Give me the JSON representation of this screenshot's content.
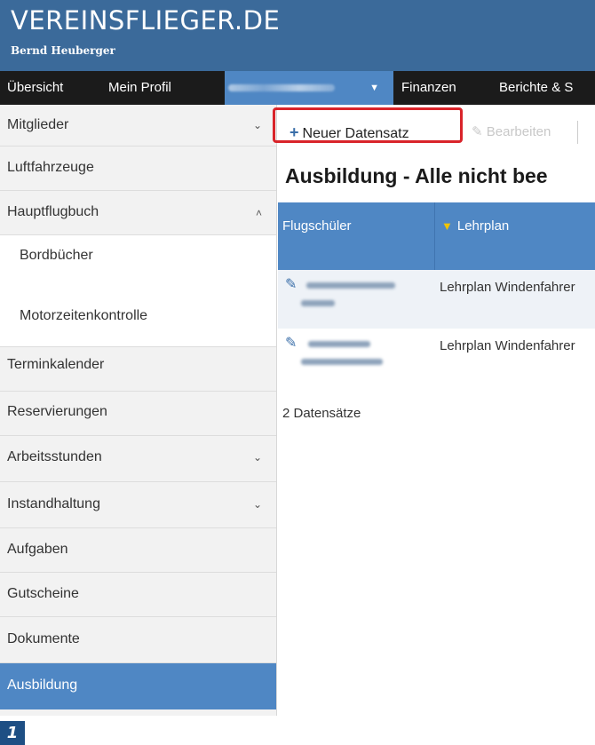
{
  "header": {
    "brand": "VEREINSFLIEGER.DE",
    "username": "Bernd Heuberger",
    "background_color": "#3b6a9a"
  },
  "navbar": {
    "items": [
      {
        "label": "Übersicht"
      },
      {
        "label": "Mein Profil"
      },
      {
        "label": "",
        "redacted": true,
        "active": true,
        "dropdown": true
      },
      {
        "label": "Finanzen"
      },
      {
        "label": "Berichte & S"
      }
    ],
    "active_color": "#4f87c4"
  },
  "sidebar": {
    "items": [
      {
        "label": "Mitglieder",
        "chevron": "chevron-down-icon"
      },
      {
        "label": "Luftfahrzeuge"
      },
      {
        "label": "Hauptflugbuch",
        "chevron": "chevron-up-icon"
      },
      {
        "label": "Bordbücher",
        "sub": true
      },
      {
        "label": "Motorzeitenkontrolle",
        "sub": true
      },
      {
        "label": "Terminkalender"
      },
      {
        "label": "Reservierungen"
      },
      {
        "label": "Arbeitsstunden",
        "chevron": "chevron-down-icon"
      },
      {
        "label": "Instandhaltung",
        "chevron": "chevron-down-icon"
      },
      {
        "label": "Aufgaben"
      },
      {
        "label": "Gutscheine"
      },
      {
        "label": "Dokumente"
      },
      {
        "label": "Ausbildung",
        "active": true
      }
    ]
  },
  "toolbar": {
    "new_label": "Neuer Datensatz",
    "new_icon": "plus-icon",
    "edit_label": "Bearbeiten",
    "edit_icon": "pencil-icon",
    "highlight_color": "#d9242a"
  },
  "main": {
    "heading": "Ausbildung - Alle nicht bee"
  },
  "grid": {
    "columns": [
      {
        "label": "Flugschüler"
      },
      {
        "label": "Lehrplan",
        "filter_icon": "filter-icon"
      }
    ],
    "rows": [
      {
        "student": "",
        "student_redacted": true,
        "lehrplan": "Lehrplan Windenfahrer"
      },
      {
        "student": "",
        "student_redacted": true,
        "lehrplan": "Lehrplan Windenfahrer"
      }
    ],
    "record_count": "2 Datensätze"
  },
  "figure_badge": "1"
}
